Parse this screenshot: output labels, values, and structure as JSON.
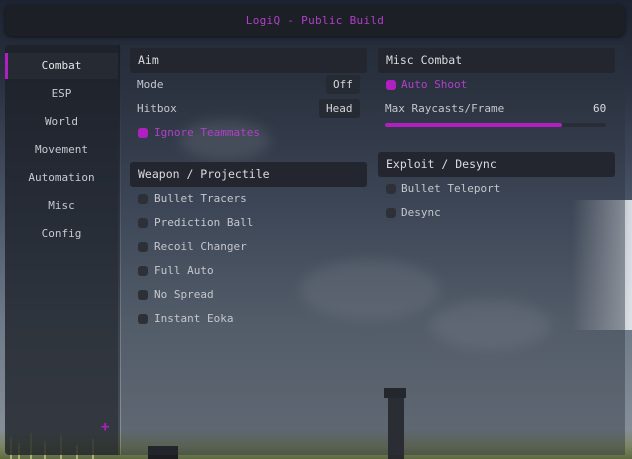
{
  "window": {
    "title": "LogiQ - Public Build"
  },
  "sidebar": {
    "items": [
      {
        "label": "Combat",
        "active": true
      },
      {
        "label": "ESP"
      },
      {
        "label": "World"
      },
      {
        "label": "Movement"
      },
      {
        "label": "Automation"
      },
      {
        "label": "Misc"
      },
      {
        "label": "Config"
      }
    ],
    "add_icon": "plus-icon"
  },
  "aim": {
    "header": "Aim",
    "mode": {
      "label": "Mode",
      "value": "Off"
    },
    "hitbox": {
      "label": "Hitbox",
      "value": "Head"
    },
    "ignore_teammates": {
      "label": "Ignore Teammates",
      "checked": true
    }
  },
  "weapon": {
    "header": "Weapon / Projectile",
    "items": [
      {
        "label": "Bullet Tracers",
        "checked": false
      },
      {
        "label": "Prediction Ball",
        "checked": false
      },
      {
        "label": "Recoil Changer",
        "checked": false
      },
      {
        "label": "Full Auto",
        "checked": false
      },
      {
        "label": "No Spread",
        "checked": false
      },
      {
        "label": "Instant Eoka",
        "checked": false
      }
    ]
  },
  "misc_combat": {
    "header": "Misc Combat",
    "auto_shoot": {
      "label": "Auto Shoot",
      "checked": true
    },
    "raycasts": {
      "label": "Max Raycasts/Frame",
      "value": "60",
      "fill": 0.8
    }
  },
  "exploit": {
    "header": "Exploit / Desync",
    "items": [
      {
        "label": "Bullet Teleport",
        "checked": false
      },
      {
        "label": "Desync",
        "checked": false
      }
    ]
  },
  "colors": {
    "accent": "#b020c0",
    "panel": "#23262e"
  }
}
